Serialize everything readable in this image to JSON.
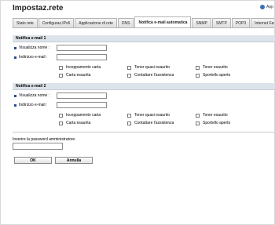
{
  "header": {
    "title": "Impostaz.rete",
    "help_label": "App"
  },
  "tabs": [
    {
      "label": "Stato rete"
    },
    {
      "label": "Configuraz.IPv6"
    },
    {
      "label": "Applicazione di rete"
    },
    {
      "label": "DNS"
    },
    {
      "label": "Notifica e-mail automatica"
    },
    {
      "label": "SNMP"
    },
    {
      "label": "SMTP"
    },
    {
      "label": "POP3"
    },
    {
      "label": "Internet Fax"
    }
  ],
  "active_tab": 4,
  "sections": [
    {
      "title": "Notifica e-mail 1",
      "display_name_label": "Visualizza nome :",
      "display_name_value": "",
      "email_label": "Indirizzo e-mail :",
      "email_value": "",
      "checkboxes": [
        {
          "label": "Inceppamento carta",
          "checked": false
        },
        {
          "label": "Toner quasi esaurito",
          "checked": false
        },
        {
          "label": "Toner esaurito",
          "checked": false
        },
        {
          "label": "Carta esaurita",
          "checked": false
        },
        {
          "label": "Contattare l'assistenza",
          "checked": false
        },
        {
          "label": "Sportello aperto",
          "checked": false
        }
      ]
    },
    {
      "title": "Notifica e-mail 2",
      "display_name_label": "Visualizza nome :",
      "display_name_value": "",
      "email_label": "Indirizzo e-mail :",
      "email_value": "",
      "checkboxes": [
        {
          "label": "Inceppamento carta",
          "checked": false
        },
        {
          "label": "Toner quasi esaurito",
          "checked": false
        },
        {
          "label": "Toner esaurito",
          "checked": false
        },
        {
          "label": "Carta esaurita",
          "checked": false
        },
        {
          "label": "Contattare l'assistenza",
          "checked": false
        },
        {
          "label": "Sportello aperto",
          "checked": false
        }
      ]
    }
  ],
  "admin": {
    "password_label": "Inserire la password amministratore.",
    "password_value": ""
  },
  "buttons": {
    "ok_label": "OK",
    "cancel_label": "Annulla"
  },
  "colors": {
    "section_header_bg": "#dde3ea",
    "bullet": "#2b4b8a",
    "help_icon": "#3a6fb8"
  }
}
